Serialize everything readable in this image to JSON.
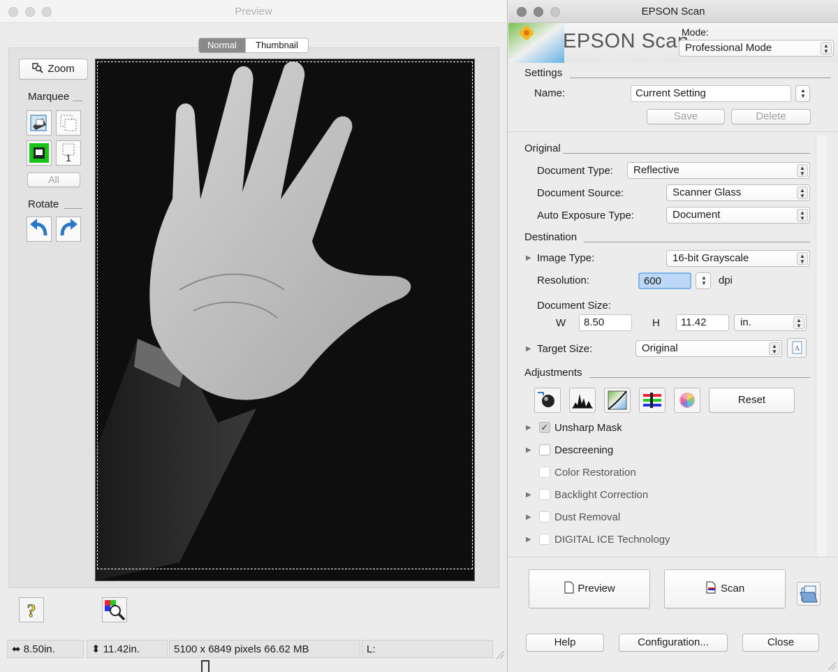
{
  "preview_window": {
    "title": "Preview",
    "view_tabs": [
      "Normal",
      "Thumbnail"
    ],
    "zoom_label": "Zoom",
    "marquee_label": "Marquee",
    "marquee_count": "1",
    "all_label": "All",
    "rotate_label": "Rotate",
    "status": {
      "width": "8.50in.",
      "height": "11.42in.",
      "pixels": "5100 x 6849 pixels 66.62 MB",
      "level": "L:"
    }
  },
  "epson_window": {
    "title": "EPSON Scan",
    "logo_text": "EPSON Scan",
    "mode_label": "Mode:",
    "mode_value": "Professional Mode",
    "settings": {
      "section": "Settings",
      "name_label": "Name:",
      "name_value": "Current Setting",
      "save_label": "Save",
      "delete_label": "Delete"
    },
    "original": {
      "section": "Original",
      "document_type_label": "Document Type:",
      "document_type_value": "Reflective",
      "document_source_label": "Document Source:",
      "document_source_value": "Scanner Glass",
      "auto_exposure_label": "Auto Exposure Type:",
      "auto_exposure_value": "Document"
    },
    "destination": {
      "section": "Destination",
      "image_type_label": "Image Type:",
      "image_type_value": "16-bit Grayscale",
      "resolution_label": "Resolution:",
      "resolution_value": "600",
      "dpi_label": "dpi",
      "document_size_label": "Document Size:",
      "w_label": "W",
      "w_value": "8.50",
      "h_label": "H",
      "h_value": "11.42",
      "unit_value": "in.",
      "target_size_label": "Target Size:",
      "target_size_value": "Original"
    },
    "adjustments": {
      "section": "Adjustments",
      "reset_label": "Reset",
      "options": [
        {
          "label": "Unsharp Mask",
          "checked": true
        },
        {
          "label": "Descreening",
          "checked": false
        },
        {
          "label": "Color Restoration",
          "checked": false
        },
        {
          "label": "Backlight Correction",
          "checked": false
        },
        {
          "label": "Dust Removal",
          "checked": false
        },
        {
          "label": "DIGITAL ICE Technology",
          "checked": false
        }
      ]
    },
    "preview_button": "Preview",
    "scan_button": "Scan",
    "help_button": "Help",
    "configuration_button": "Configuration...",
    "close_button": "Close"
  }
}
